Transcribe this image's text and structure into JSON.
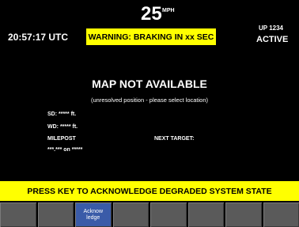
{
  "header": {
    "speed_value": "25",
    "speed_unit": "MPH",
    "clock": "20:57:17 UTC",
    "warning": "WARNING: BRAKING IN xx SEC",
    "train_id": "UP 1234",
    "status": "ACTIVE"
  },
  "map": {
    "title": "MAP NOT AVAILABLE",
    "subtitle": "(unresolved position - please select location)"
  },
  "fields": {
    "sd": "SD:  ***** ft.",
    "wd": "WD:  ***** ft.",
    "milepost_label": "MILEPOST",
    "milepost_value": "***.*** on *****",
    "next_target_label": "NEXT TARGET:"
  },
  "alert_bar": {
    "text": "PRESS KEY TO ACKNOWLEDGE DEGRADED SYSTEM STATE"
  },
  "softkeys": {
    "key3_line1": "Acknow",
    "key3_line2": "ledge"
  },
  "colors": {
    "background": "#000000",
    "warning_bg": "#ffff00",
    "softkey": "#5a5a5a",
    "softkey_active": "#3a5ba8"
  }
}
